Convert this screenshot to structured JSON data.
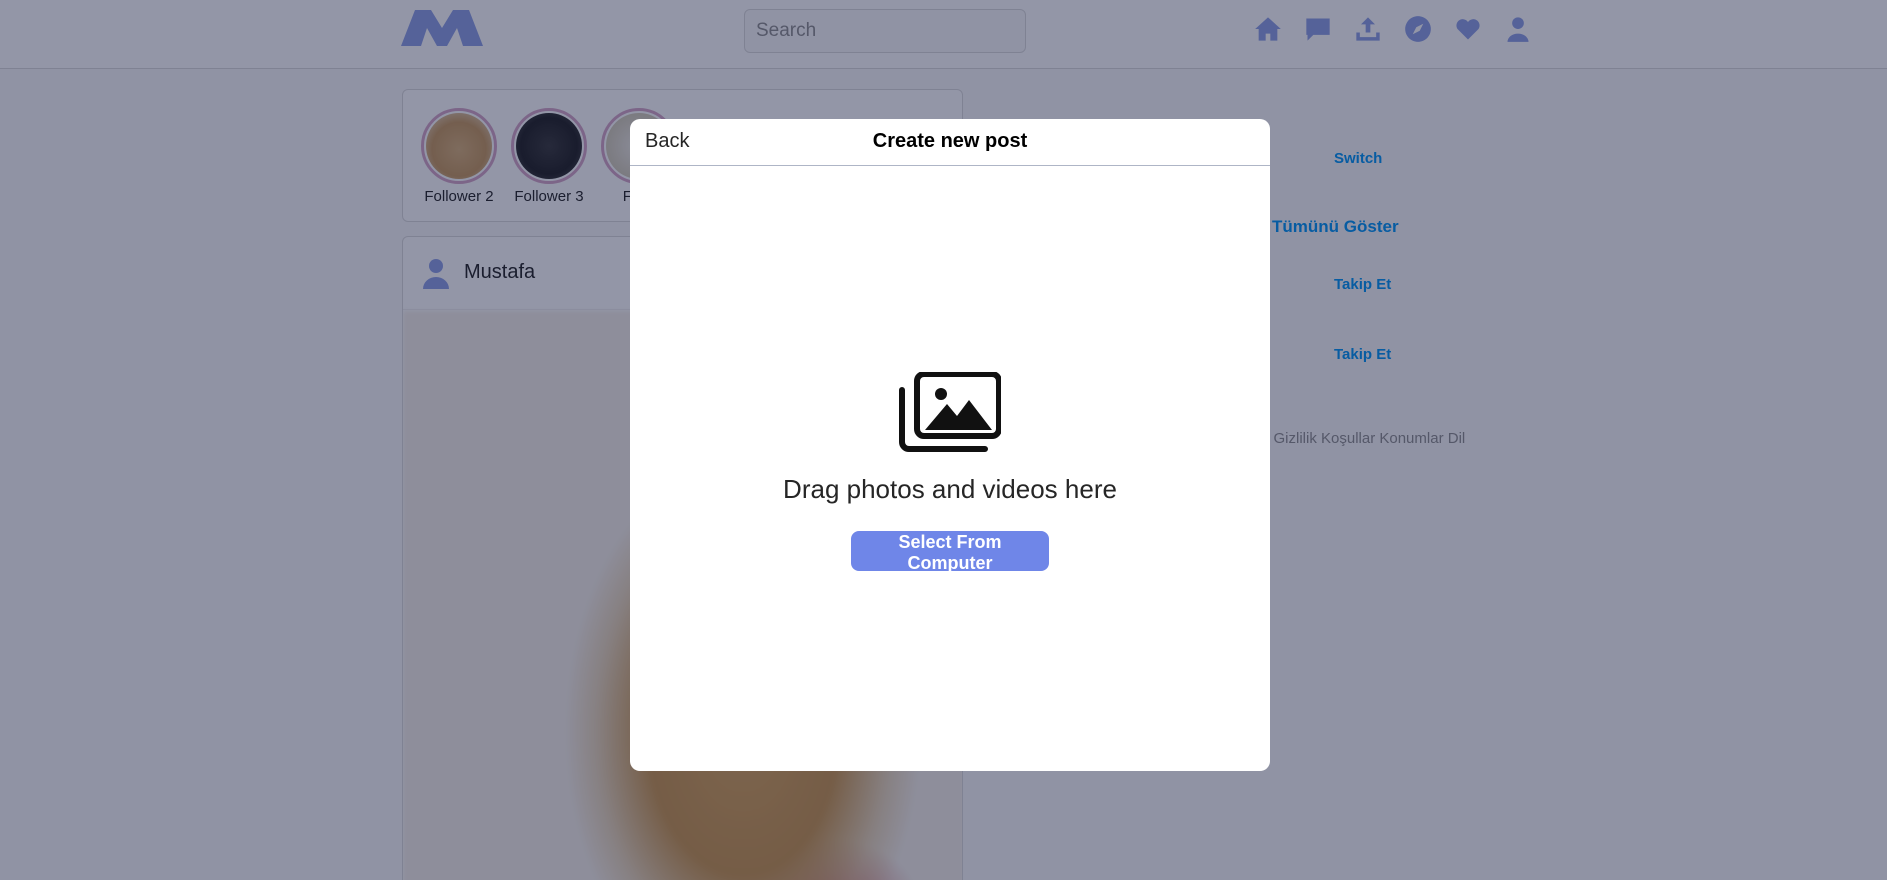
{
  "header": {
    "logo_icon": "logo-icon",
    "search_placeholder": "Search",
    "nav_icons": [
      "home-icon",
      "messages-icon",
      "upload-icon",
      "explore-icon",
      "heart-icon",
      "profile-icon"
    ],
    "accent_color": "#8ea0e6"
  },
  "stories": [
    {
      "label": "Follower 2"
    },
    {
      "label": "Follower 3"
    },
    {
      "label": "Follo"
    }
  ],
  "post": {
    "username": "Mustafa"
  },
  "sidebar": {
    "switch_label": "Switch",
    "see_all_label": "Tümünü Göster",
    "follow_labels": [
      "Takip Et",
      "Takip Et"
    ],
    "footer_text": "n Gizlilik Koşullar Konumlar Dil"
  },
  "modal": {
    "back_label": "Back",
    "title": "Create new post",
    "message": "Drag photos and videos here",
    "button_label": "Select From Computer",
    "button_color": "#6f86e8"
  }
}
